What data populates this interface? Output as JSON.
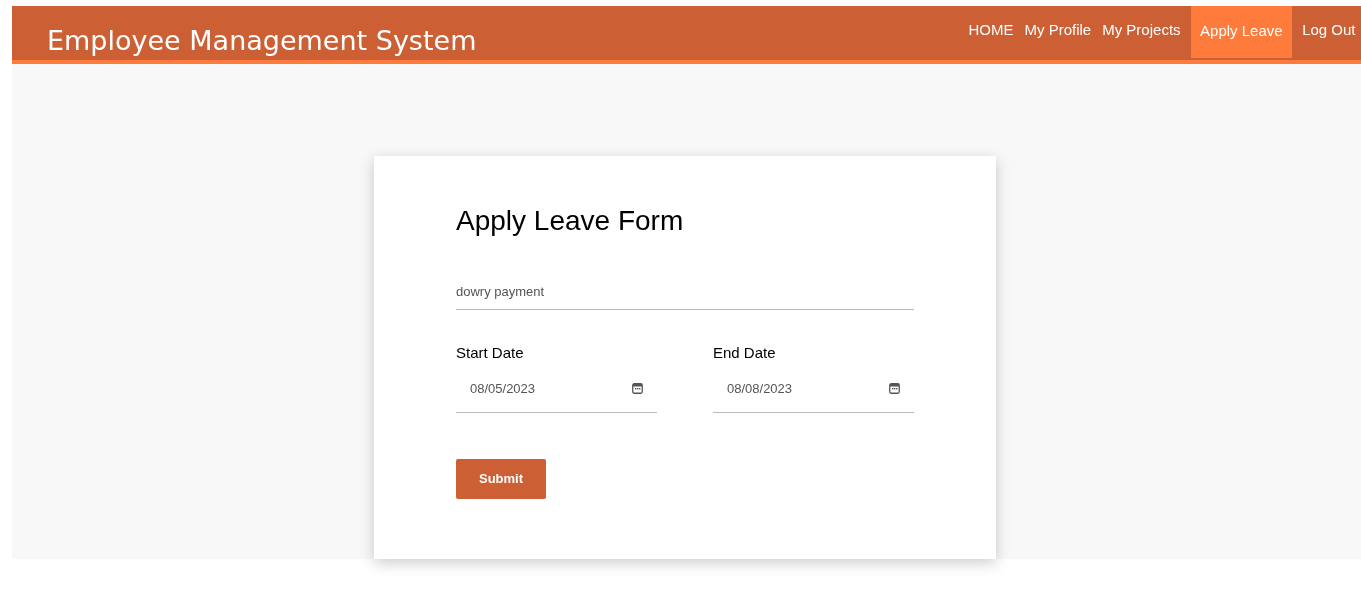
{
  "navbar": {
    "brand": "Employee Management System",
    "links": [
      {
        "label": "HOME",
        "selected": false
      },
      {
        "label": "My Profile",
        "selected": false
      },
      {
        "label": "My Projects",
        "selected": false
      },
      {
        "label": "Apply Leave",
        "selected": true
      },
      {
        "label": "Log Out",
        "selected": false
      }
    ]
  },
  "form": {
    "title": "Apply Leave Form",
    "reason": {
      "value": "dowry payment"
    },
    "dates": [
      {
        "label": "Start Date",
        "value": "08/05/2023"
      },
      {
        "label": "End Date",
        "value": "08/08/2023"
      }
    ],
    "submit": "Submit"
  }
}
